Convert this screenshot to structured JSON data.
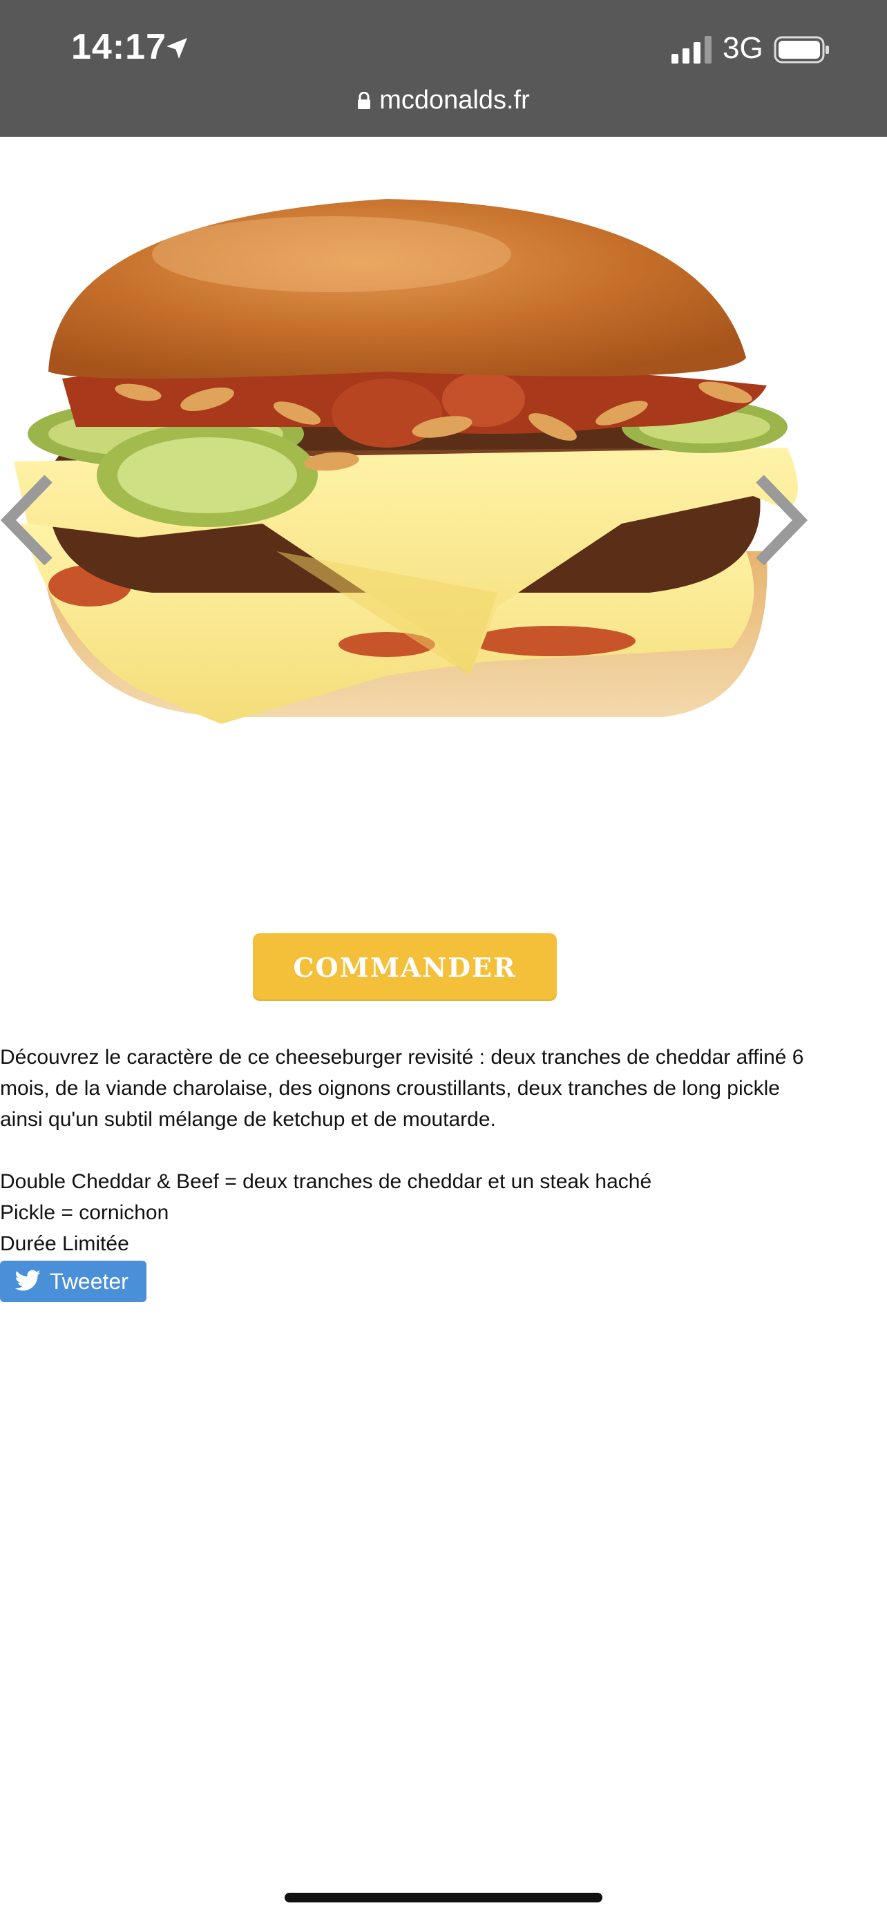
{
  "status_bar": {
    "time": "14:17",
    "network": "3G",
    "url": "mcdonalds.fr"
  },
  "product": {
    "image_icon": "double-cheddar-beef-burger",
    "order_button": "COMMANDER",
    "description": "Découvrez le caractère de ce cheeseburger revisité : deux tranches de cheddar affiné 6 mois, de la viande charolaise, des oignons croustillants, deux tranches de long pickle ainsi qu'un subtil mélange de ketchup et de moutarde.",
    "details": [
      "Double Cheddar & Beef =  deux tranches de cheddar et un steak haché",
      "Pickle = cornichon",
      "Durée Limitée"
    ],
    "tweet_label": "Tweeter"
  },
  "colors": {
    "status_bar_bg": "#585858",
    "order_button_bg": "#f4c03a",
    "tweet_button_bg": "#4a90d9"
  }
}
